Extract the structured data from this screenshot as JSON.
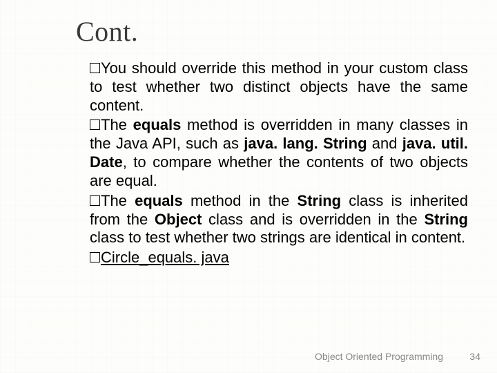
{
  "title": "Cont.",
  "bullets": {
    "b0": {
      "lead": "You",
      "rest": " should override this method in your custom class to test whether two distinct objects have the same content."
    },
    "b1": {
      "lead": "The ",
      "kw1": "equals",
      "mid1": " method is overridden in many classes in the Java API, such as ",
      "kw2": "java. lang. String",
      "mid2": " and ",
      "kw3": "java. util. Date",
      "rest": ", to compare whether the contents of two objects are equal."
    },
    "b2": {
      "lead": "The ",
      "kw1": "equals",
      "mid1": " method in the ",
      "kw2": "String",
      "mid2": " class is inherited from the ",
      "kw3": "Object",
      "mid3": " class and is overridden in the ",
      "kw4": "String",
      "rest": " class to test whether two strings are identical in content."
    },
    "b3": {
      "link": "Circle_equals. java"
    }
  },
  "footer": {
    "text": "Object Oriented Programming",
    "page": "34"
  }
}
